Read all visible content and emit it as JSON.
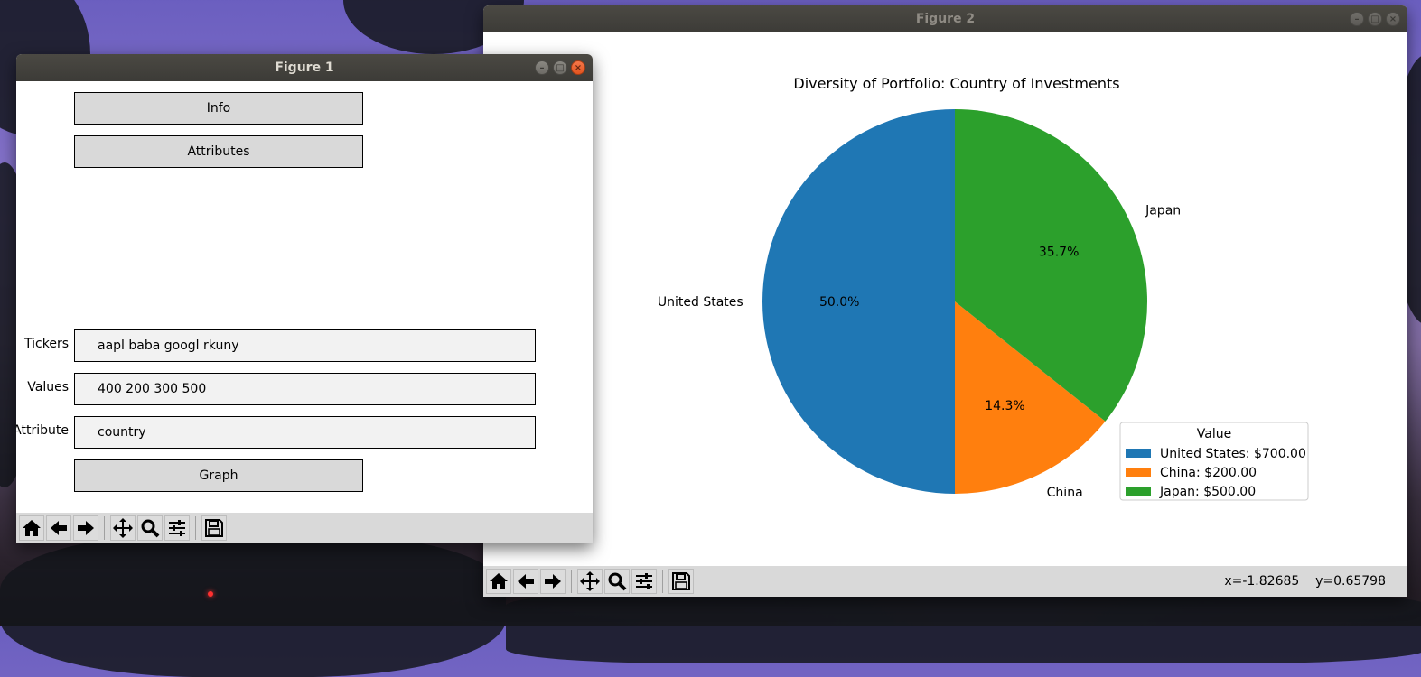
{
  "figure1": {
    "title": "Figure 1",
    "buttons": {
      "info": "Info",
      "attributes": "Attributes",
      "graph": "Graph"
    },
    "fields": [
      {
        "label": "Tickers",
        "value": "aapl baba googl rkuny"
      },
      {
        "label": "Values",
        "value": "400 200 300 500"
      },
      {
        "label": "Attribute",
        "value": "country"
      }
    ]
  },
  "figure2": {
    "title": "Figure 2",
    "coords": "x=-1.82685    y=0.65798"
  },
  "toolbar_icons": [
    "home-icon",
    "back-arrow-icon",
    "forward-arrow-icon",
    "pan-icon",
    "zoom-icon",
    "configure-subplots-icon",
    "save-icon"
  ],
  "chart_data": {
    "type": "pie",
    "title": "Diversity of Portfolio: Country of Investments",
    "categories": [
      "United States",
      "China",
      "Japan"
    ],
    "values": [
      700,
      200,
      500
    ],
    "percent_labels": [
      "50.0%",
      "14.3%",
      "35.7%"
    ],
    "colors": [
      "#1f77b4",
      "#ff7f0e",
      "#2ca02c"
    ],
    "legend": {
      "title": "Value",
      "placement": "lower-right",
      "entries": [
        "United States: $700.00",
        "China: $200.00",
        "Japan: $500.00"
      ]
    },
    "start_angle_deg": 90,
    "direction": "counterclockwise"
  }
}
